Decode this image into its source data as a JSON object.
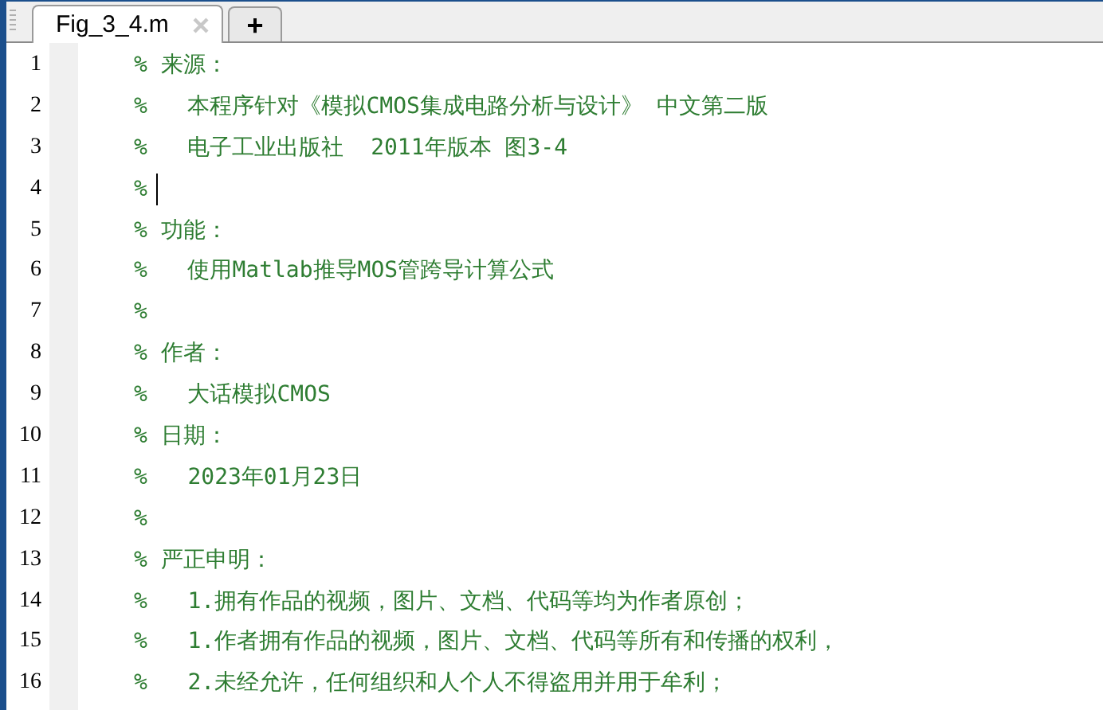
{
  "tabs": [
    {
      "label": "Fig_3_4.m",
      "selected": true
    }
  ],
  "new_tab": {
    "label": "+"
  },
  "lines": [
    {
      "number": "1",
      "text": "% 来源：",
      "cursor": false
    },
    {
      "number": "2",
      "text": "%   本程序针对《模拟CMOS集成电路分析与设计》 中文第二版",
      "cursor": false
    },
    {
      "number": "3",
      "text": "%   电子工业出版社  2011年版本 图3-4",
      "cursor": false
    },
    {
      "number": "4",
      "text": "%",
      "cursor": true
    },
    {
      "number": "5",
      "text": "% 功能：",
      "cursor": false
    },
    {
      "number": "6",
      "text": "%   使用Matlab推导MOS管跨导计算公式",
      "cursor": false
    },
    {
      "number": "7",
      "text": "%",
      "cursor": false
    },
    {
      "number": "8",
      "text": "% 作者：",
      "cursor": false
    },
    {
      "number": "9",
      "text": "%   大话模拟CMOS",
      "cursor": false
    },
    {
      "number": "10",
      "text": "% 日期：",
      "cursor": false
    },
    {
      "number": "11",
      "text": "%   2023年01月23日",
      "cursor": false
    },
    {
      "number": "12",
      "text": "%",
      "cursor": false
    },
    {
      "number": "13",
      "text": "% 严正申明：",
      "cursor": false
    },
    {
      "number": "14",
      "text": "%   1.拥有作品的视频，图片、文档、代码等均为作者原创；",
      "cursor": false
    },
    {
      "number": "15",
      "text": "%   1.作者拥有作品的视频，图片、文档、代码等所有和传播的权利，",
      "cursor": false
    },
    {
      "number": "16",
      "text": "%   2.未经允许，任何组织和人个人不得盗用并用于牟利；",
      "cursor": false
    }
  ]
}
